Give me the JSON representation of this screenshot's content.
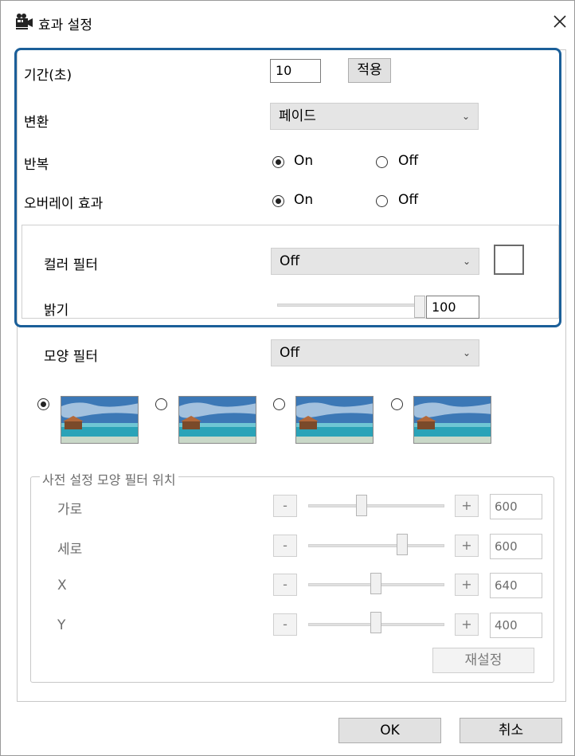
{
  "title": "효과 설정",
  "duration": {
    "label": "기간(초)",
    "value": "10",
    "apply_label": "적용"
  },
  "transition": {
    "label": "변환",
    "selected": "페이드"
  },
  "repeat": {
    "label": "반복",
    "on_label": "On",
    "off_label": "Off",
    "selected": "On"
  },
  "overlay": {
    "label": "오버레이 효과",
    "on_label": "On",
    "off_label": "Off",
    "selected": "On"
  },
  "color_filter": {
    "label": "컬러 필터",
    "selected": "Off"
  },
  "brightness": {
    "label": "밝기",
    "value": "100",
    "level": 1.0
  },
  "shape_filter": {
    "label": "모양 필터",
    "selected": "Off",
    "selected_thumbnail": 1
  },
  "preset_position": {
    "legend": "사전 설정 모양 필터 위치",
    "rows": [
      {
        "label": "가로",
        "value": "600",
        "minus": "-",
        "plus": "+"
      },
      {
        "label": "세로",
        "value": "600",
        "minus": "-",
        "plus": "+"
      },
      {
        "label": "X",
        "value": "640",
        "minus": "-",
        "plus": "+"
      },
      {
        "label": "Y",
        "value": "400",
        "minus": "-",
        "plus": "+"
      }
    ],
    "reset_label": "재설정"
  },
  "footer": {
    "ok_label": "OK",
    "cancel_label": "취소"
  },
  "colors": {
    "highlight": "#1b5f99"
  },
  "icons": {
    "title": "projector-icon",
    "close": "close-icon"
  }
}
